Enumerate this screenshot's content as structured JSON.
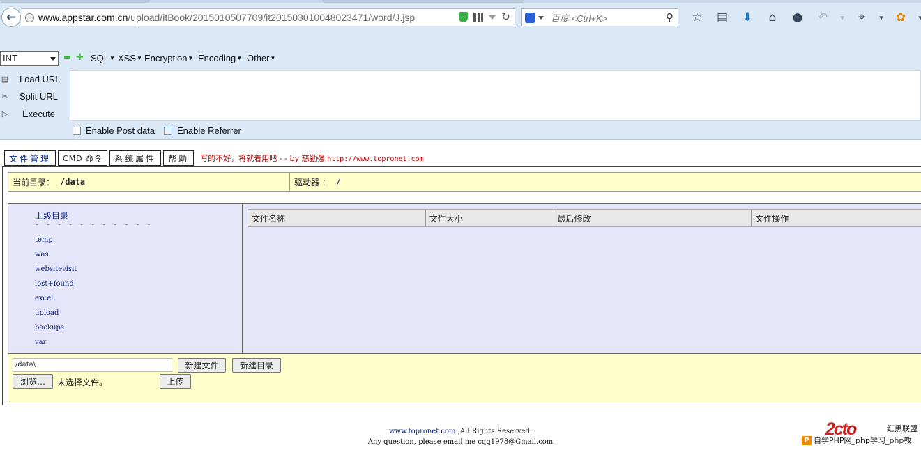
{
  "browser": {
    "url_host": "www.appstar.com.cn",
    "url_path": "/upload/itBook/2015010507709/it2015030100480234​71/word/J.jsp",
    "search_placeholder": "百度 <Ctrl+K>"
  },
  "hackbar": {
    "select_value": "INT",
    "menus": [
      "SQL",
      "XSS",
      "Encryption",
      "Encoding",
      "Other"
    ],
    "load_url": "Load URL",
    "split_url": "Split URL",
    "execute": "Execute",
    "enable_post": "Enable Post data",
    "enable_referrer": "Enable Referrer"
  },
  "page": {
    "tabs": [
      "文件管理",
      "CMD 命令",
      "系统属性",
      "帮助"
    ],
    "credit_text": "写的不好，将就着用吧 - - by 慈勤强",
    "credit_link": "http://www.topronet.com",
    "current_dir_label": "当前目录：",
    "current_dir_value": "/data",
    "drive_label": "驱动器 ：",
    "drive_value": "/",
    "parent_dir": "上级目录",
    "parent_dash": "- - - - - - - - - - -",
    "dirs": [
      "temp",
      "was",
      "websitevisit",
      "lost+found",
      "excel",
      "upload",
      "backups",
      "var"
    ],
    "columns": [
      "文件名称",
      "文件大小",
      "最后修改",
      "文件操作"
    ],
    "path_input_value": "/data\\",
    "new_file": "新建文件",
    "new_dir": "新建目录",
    "browse": "浏览…",
    "no_file": "未选择文件。",
    "upload": "上传",
    "footer_link": "www.topronet.com",
    "footer_rights": ",All Rights Reserved.",
    "footer_email": "Any question, please email me cqq1978@Gmail.com"
  },
  "watermark": {
    "mark": "2cto",
    "sub": "红黑联盟",
    "bar_icon": "P",
    "bar_text": "自学PHP网_php学习_php教"
  }
}
